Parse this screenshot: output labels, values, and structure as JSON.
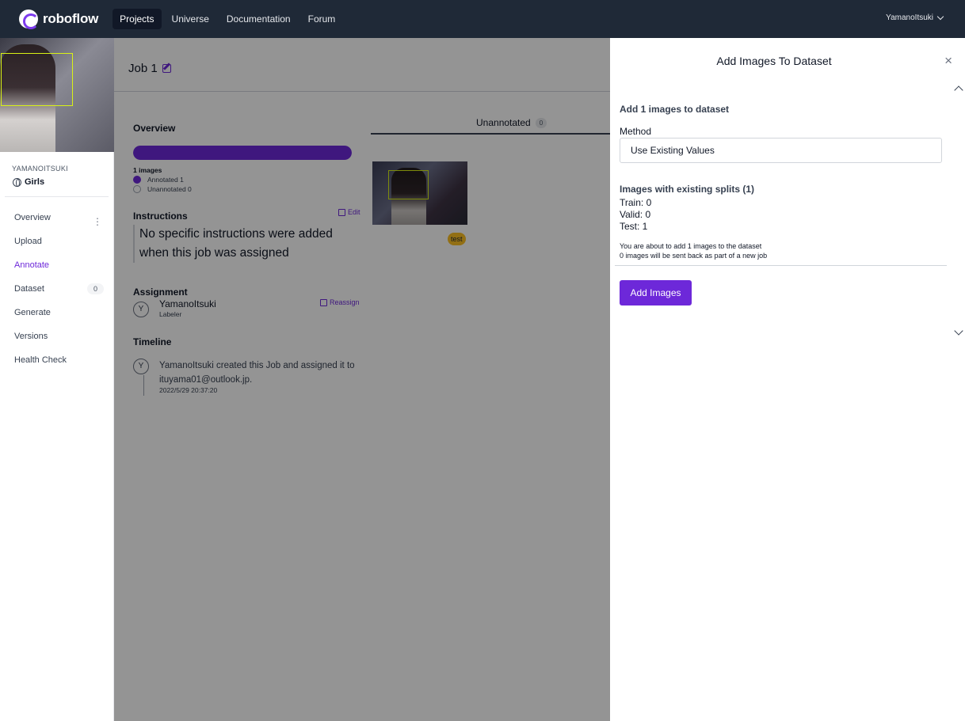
{
  "nav": {
    "brand": "roboflow",
    "links": [
      "Projects",
      "Universe",
      "Documentation",
      "Forum"
    ],
    "user": "YamanoItsuki"
  },
  "sidebar": {
    "owner": "YAMANOITSUKI",
    "project": "Girls",
    "items": [
      {
        "label": "Overview"
      },
      {
        "label": "Upload"
      },
      {
        "label": "Annotate"
      },
      {
        "label": "Dataset",
        "count": "0"
      },
      {
        "label": "Generate"
      },
      {
        "label": "Versions"
      },
      {
        "label": "Health Check"
      }
    ]
  },
  "job": {
    "title": "Job 1",
    "overview": {
      "heading": "Overview",
      "progress": 1.0,
      "image_count": "1 images",
      "annotated": "Annotated 1",
      "unannotated": "Unannotated 0"
    },
    "instructions": {
      "heading": "Instructions",
      "edit": "Edit",
      "text": "No specific instructions were added when this job was assigned"
    },
    "assignment": {
      "heading": "Assignment",
      "avatar": "Y",
      "name": "YamanoItsuki",
      "role": "Labeler",
      "reassign": "Reassign"
    },
    "timeline": {
      "heading": "Timeline",
      "avatar": "Y",
      "text": "YamanoItsuki created this Job and assigned it to ituyama01@outlook.jp.",
      "date": "2022/5/29 20:37:20"
    },
    "tab": {
      "label": "Unannotated",
      "count": "0"
    },
    "tag": "test"
  },
  "drawer": {
    "title": "Add Images To Dataset",
    "close": "×",
    "heading": "Add 1 images to dataset",
    "method_label": "Method",
    "method_value": "Use Existing Values",
    "splits_heading": "Images with existing splits (1)",
    "train": "Train: 0",
    "valid": "Valid: 0",
    "test": "Test: 1",
    "note1": "You are about to add 1 images to the dataset",
    "note2": "0 images will be sent back as part of a new job",
    "button": "Add Images"
  }
}
